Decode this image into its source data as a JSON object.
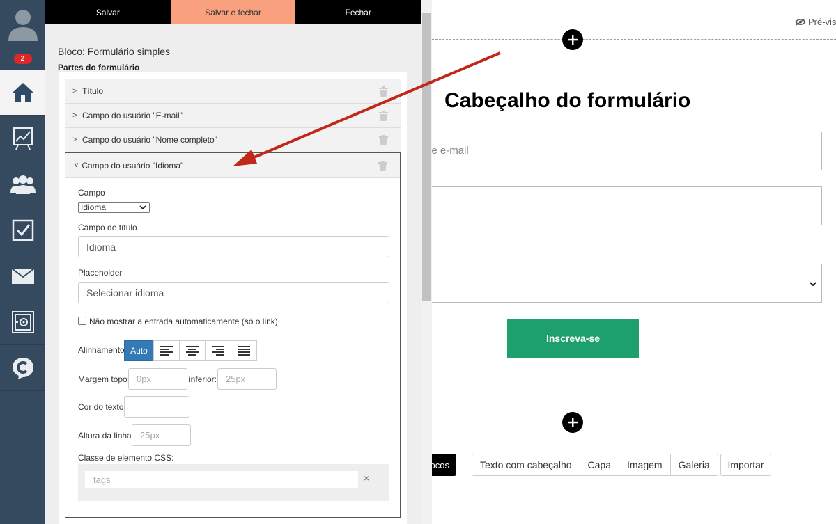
{
  "toolbar": {
    "save": "Salvar",
    "save_close": "Salvar e fechar",
    "close": "Fechar"
  },
  "nav": {
    "notification_count": "2",
    "items": [
      "avatar-icon",
      "home-icon",
      "stats-icon",
      "users-icon",
      "tasks-icon",
      "mail-icon",
      "safe-icon",
      "chat-icon"
    ]
  },
  "panel": {
    "block_title": "Bloco: Formulário simples",
    "parts_label": "Partes do formulário",
    "parts": [
      "Título",
      "Campo do usuário \"E-mail\"",
      "Campo do usuário \"Nome completo\"",
      "Campo do usuário \"Idioma\""
    ],
    "field": {
      "label": "Campo",
      "value": "Idioma"
    },
    "title_field": {
      "label": "Campo de título",
      "value": "Idioma"
    },
    "placeholder": {
      "label": "Placeholder",
      "value": "Selecionar idioma"
    },
    "auto_hide_label": "Não mostrar a entrada automaticamente (só o link)",
    "alignment": {
      "label": "Alinhamento",
      "auto": "Auto"
    },
    "margin": {
      "top_label": "Margem topo:",
      "top_placeholder": "0px",
      "bottom_label": "inferior:",
      "bottom_placeholder": "25px"
    },
    "text_color_label": "Cor do texto:",
    "line_height": {
      "label": "Altura da linha:",
      "placeholder": "25px"
    },
    "css_class": {
      "label": "Classe de elemento CSS:",
      "placeholder": "tags",
      "clear": "×"
    }
  },
  "canvas": {
    "preview": "Pré-vis",
    "form_title": "Cabeçalho do formulário",
    "email_placeholder": "de e-mail",
    "subscribe": "Inscreva-se",
    "blocks_btn": "ocos",
    "block_types": [
      "Texto com cabeçalho",
      "Capa",
      "Imagem",
      "Galeria"
    ],
    "import": "Importar"
  },
  "colors": {
    "nav_bg": "#354a5e",
    "accent": "#f9a07e",
    "primary": "#337ab7",
    "subscribe": "#1d9f6e",
    "arrow": "#c0291a"
  }
}
